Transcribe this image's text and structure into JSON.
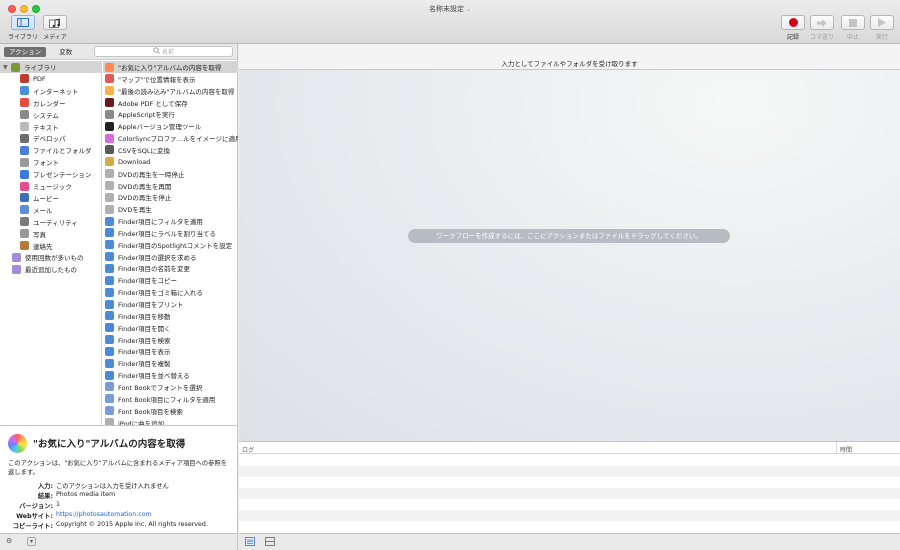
{
  "window": {
    "title": "名称未設定",
    "title_chevron": "⌄"
  },
  "toolbar": {
    "library_label": "ライブラリ",
    "media_label": "メディア",
    "record_label": "記録",
    "step_label": "コマ送り",
    "stop_label": "中止",
    "run_label": "実行"
  },
  "left_header": {
    "tab_actions": "アクション",
    "tab_variables": "変数",
    "search_placeholder": "名前"
  },
  "library": [
    {
      "label": "ライブラリ",
      "color": "#7a9a3a",
      "top": true
    },
    {
      "label": "PDF",
      "color": "#c0392b"
    },
    {
      "label": "インターネット",
      "color": "#4a90d9"
    },
    {
      "label": "カレンダー",
      "color": "#e74c3c"
    },
    {
      "label": "システム",
      "color": "#8a8a8a"
    },
    {
      "label": "テキスト",
      "color": "#bbbbbb"
    },
    {
      "label": "デベロッパ",
      "color": "#6d6d6d"
    },
    {
      "label": "ファイルとフォルダ",
      "color": "#4a7fd9"
    },
    {
      "label": "フォント",
      "color": "#9a9a9a"
    },
    {
      "label": "プレゼンテーション",
      "color": "#3a7ad9"
    },
    {
      "label": "ミュージック",
      "color": "#e84c8c"
    },
    {
      "label": "ムービー",
      "color": "#3b6fb6"
    },
    {
      "label": "メール",
      "color": "#5b8fd6"
    },
    {
      "label": "ユーティリティ",
      "color": "#7a7a7a"
    },
    {
      "label": "写真",
      "color": "#999999"
    },
    {
      "label": "連絡先",
      "color": "#b5793c"
    },
    {
      "label": "使用回数が多いもの",
      "color": "#a48ad8"
    },
    {
      "label": "最近追加したもの",
      "color": "#a48ad8"
    }
  ],
  "actions": [
    {
      "label": "\"お気に入り\"アルバムの内容を取得",
      "color": "#ff8a4a",
      "selected": true
    },
    {
      "label": "\"マップ\"で位置情報を表示",
      "color": "#e05a5a"
    },
    {
      "label": "\"最後の読み込み\"アルバムの内容を取得",
      "color": "#ffb04a"
    },
    {
      "label": "Adobe PDF として保存",
      "color": "#6a1a1a"
    },
    {
      "label": "AppleScriptを実行",
      "color": "#8a8a8a"
    },
    {
      "label": "Appleバージョン管理ツール",
      "color": "#222222"
    },
    {
      "label": "ColorSyncプロファ…ルをイメージに適用",
      "color": "#d96ad9"
    },
    {
      "label": "CSVをSQLに変換",
      "color": "#5a5a5a"
    },
    {
      "label": "Download",
      "color": "#d9a84a"
    },
    {
      "label": "DVDの再生を一時停止",
      "color": "#b0b0b0"
    },
    {
      "label": "DVDの再生を再開",
      "color": "#b0b0b0"
    },
    {
      "label": "DVDの再生を停止",
      "color": "#b0b0b0"
    },
    {
      "label": "DVDを再生",
      "color": "#b0b0b0"
    },
    {
      "label": "Finder項目にフィルタを適用",
      "color": "#4a8ad9"
    },
    {
      "label": "Finder項目にラベルを割り当てる",
      "color": "#4a8ad9"
    },
    {
      "label": "Finder項目のSpotlightコメントを設定",
      "color": "#4a8ad9"
    },
    {
      "label": "Finder項目の選択を求める",
      "color": "#4a8ad9"
    },
    {
      "label": "Finder項目の名前を変更",
      "color": "#4a8ad9"
    },
    {
      "label": "Finder項目をコピー",
      "color": "#4a8ad9"
    },
    {
      "label": "Finder項目をゴミ箱に入れる",
      "color": "#4a8ad9"
    },
    {
      "label": "Finder項目をプリント",
      "color": "#4a8ad9"
    },
    {
      "label": "Finder項目を移動",
      "color": "#4a8ad9"
    },
    {
      "label": "Finder項目を開く",
      "color": "#4a8ad9"
    },
    {
      "label": "Finder項目を検索",
      "color": "#4a8ad9"
    },
    {
      "label": "Finder項目を表示",
      "color": "#4a8ad9"
    },
    {
      "label": "Finder項目を複製",
      "color": "#4a8ad9"
    },
    {
      "label": "Finder項目を並べ替える",
      "color": "#4a8ad9"
    },
    {
      "label": "Font Bookでフォントを選択",
      "color": "#7a9ad9"
    },
    {
      "label": "Font Book項目にフィルタを適用",
      "color": "#7a9ad9"
    },
    {
      "label": "Font Book項目を検索",
      "color": "#7a9ad9"
    },
    {
      "label": "iPodに曲を追加",
      "color": "#b0b0b0"
    }
  ],
  "description": {
    "title": "\"お気に入り\"アルバムの内容を取得",
    "text": "このアクションは、\"お気に入り\"アルバムに含まれるメディア項目への参照を返します。",
    "input_label": "入力:",
    "input_value": "このアクションは入力を受け入れません",
    "result_label": "結果:",
    "result_value": "Photos media item",
    "version_label": "バージョン:",
    "version_value": "1",
    "website_label": "Webサイト:",
    "website_value": "https://photosautomation.com",
    "copyright_label": "コピーライト:",
    "copyright_value": "Copyright © 2015 Apple Inc. All rights reserved."
  },
  "workflow": {
    "header": "入力としてファイルやフォルダを受け取ります",
    "hint": "ワークフローを作成するには、ここにアクションまたはファイルをドラッグしてください。"
  },
  "log": {
    "col_log": "ログ",
    "col_time": "時間"
  },
  "bottom": {
    "gear": "⚙",
    "dropdown": "▾"
  }
}
